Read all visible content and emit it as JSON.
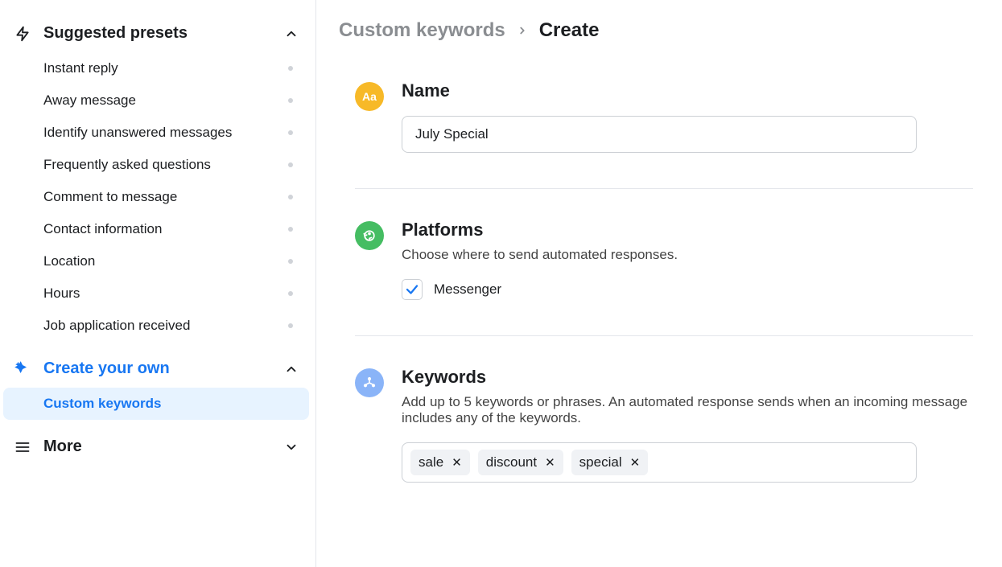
{
  "sidebar": {
    "suggested_title": "Suggested presets",
    "suggested_items": [
      {
        "label": "Instant reply"
      },
      {
        "label": "Away message"
      },
      {
        "label": "Identify unanswered messages"
      },
      {
        "label": "Frequently asked questions"
      },
      {
        "label": "Comment to message"
      },
      {
        "label": "Contact information"
      },
      {
        "label": "Location"
      },
      {
        "label": "Hours"
      },
      {
        "label": "Job application received"
      }
    ],
    "create_own_title": "Create your own",
    "create_own_items": [
      {
        "label": "Custom keywords"
      }
    ],
    "more_title": "More"
  },
  "breadcrumb": {
    "parent": "Custom keywords",
    "current": "Create"
  },
  "sections": {
    "name": {
      "title": "Name",
      "value": "July Special",
      "icon_text": "Aa"
    },
    "platforms": {
      "title": "Platforms",
      "desc": "Choose where to send automated responses.",
      "option_label": "Messenger",
      "option_checked": true
    },
    "keywords": {
      "title": "Keywords",
      "desc": "Add up to 5 keywords or phrases. An automated response sends when an incoming message includes any of the keywords.",
      "chips": [
        "sale",
        "discount",
        "special"
      ]
    }
  }
}
